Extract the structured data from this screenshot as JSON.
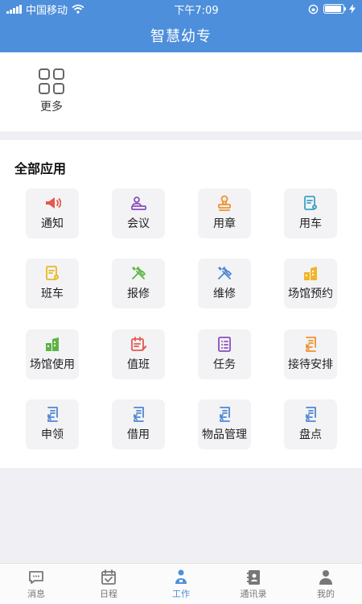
{
  "status_bar": {
    "carrier": "中国移动",
    "time": "下午7:09",
    "battery_level": 0.9
  },
  "header": {
    "title": "智慧幼专"
  },
  "quick": {
    "more_label": "更多",
    "icon": "grid-icon"
  },
  "section": {
    "title": "全部应用"
  },
  "apps": [
    {
      "label": "通知",
      "icon": "megaphone-icon",
      "color": "#e5584e"
    },
    {
      "label": "会议",
      "icon": "meeting-icon",
      "color": "#8a4fbf"
    },
    {
      "label": "用章",
      "icon": "stamp-icon",
      "color": "#f0912f"
    },
    {
      "label": "用车",
      "icon": "document-gear-icon",
      "color": "#3aa3c8"
    },
    {
      "label": "班车",
      "icon": "document-gear-icon",
      "color": "#e8b820"
    },
    {
      "label": "报修",
      "icon": "tools-icon",
      "color": "#5eb446"
    },
    {
      "label": "维修",
      "icon": "tools-icon",
      "color": "#4f86d6"
    },
    {
      "label": "场馆预约",
      "icon": "buildings-icon",
      "color": "#f1b52a"
    },
    {
      "label": "场馆使用",
      "icon": "buildings-icon",
      "color": "#5eb446"
    },
    {
      "label": "值班",
      "icon": "calendar-edit-icon",
      "color": "#e5584e"
    },
    {
      "label": "任务",
      "icon": "task-list-icon",
      "color": "#8a4fbf"
    },
    {
      "label": "接待安排",
      "icon": "document-return-icon",
      "color": "#f0912f"
    },
    {
      "label": "申领",
      "icon": "document-return-icon",
      "color": "#4f86d6"
    },
    {
      "label": "借用",
      "icon": "document-return-icon",
      "color": "#4f86d6"
    },
    {
      "label": "物品管理",
      "icon": "document-return-icon",
      "color": "#4f86d6"
    },
    {
      "label": "盘点",
      "icon": "document-return-icon",
      "color": "#4f86d6"
    }
  ],
  "tabs": [
    {
      "label": "消息",
      "icon": "chat-icon",
      "active": false
    },
    {
      "label": "日程",
      "icon": "calendar-check-icon",
      "active": false
    },
    {
      "label": "工作",
      "icon": "person-work-icon",
      "active": true
    },
    {
      "label": "通讯录",
      "icon": "contacts-book-icon",
      "active": false
    },
    {
      "label": "我的",
      "icon": "user-icon",
      "active": false
    }
  ],
  "colors": {
    "header": "#4e8fdc",
    "tab_active": "#4e8fdc",
    "tab_inactive": "#777777"
  }
}
